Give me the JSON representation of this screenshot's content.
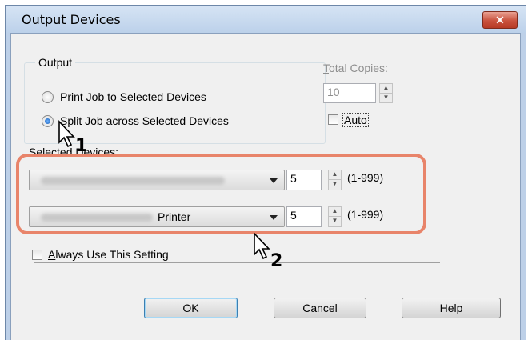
{
  "window": {
    "title": "Output Devices",
    "close_label": "✕"
  },
  "output_group": {
    "label": "Output",
    "options": [
      {
        "label": "Print Job to Selected Devices",
        "accel": "P",
        "rest": "rint Job to Selected Devices",
        "selected": false
      },
      {
        "label": "Split Job across Selected Devices",
        "accel": "S",
        "rest": "plit Job across Selected Devices",
        "selected": true
      }
    ]
  },
  "total_copies": {
    "label": "Total Copies:",
    "value": "10",
    "enabled": false
  },
  "auto": {
    "label": "Auto",
    "checked": false
  },
  "selected_devices": {
    "label": "Selected Devices:",
    "rows": [
      {
        "device_name": "",
        "copies": "5",
        "range": "(1-999)"
      },
      {
        "device_name": "Printer",
        "copies": "5",
        "range": "(1-999)"
      }
    ]
  },
  "always_use": {
    "label": "Always Use This Setting",
    "accel": "A",
    "rest": "lways Use This Setting",
    "checked": false
  },
  "buttons": {
    "ok": "OK",
    "cancel": "Cancel",
    "help": "Help"
  },
  "annotations": {
    "step1": "1",
    "step2": "2",
    "highlight_color": "#e8846a"
  }
}
